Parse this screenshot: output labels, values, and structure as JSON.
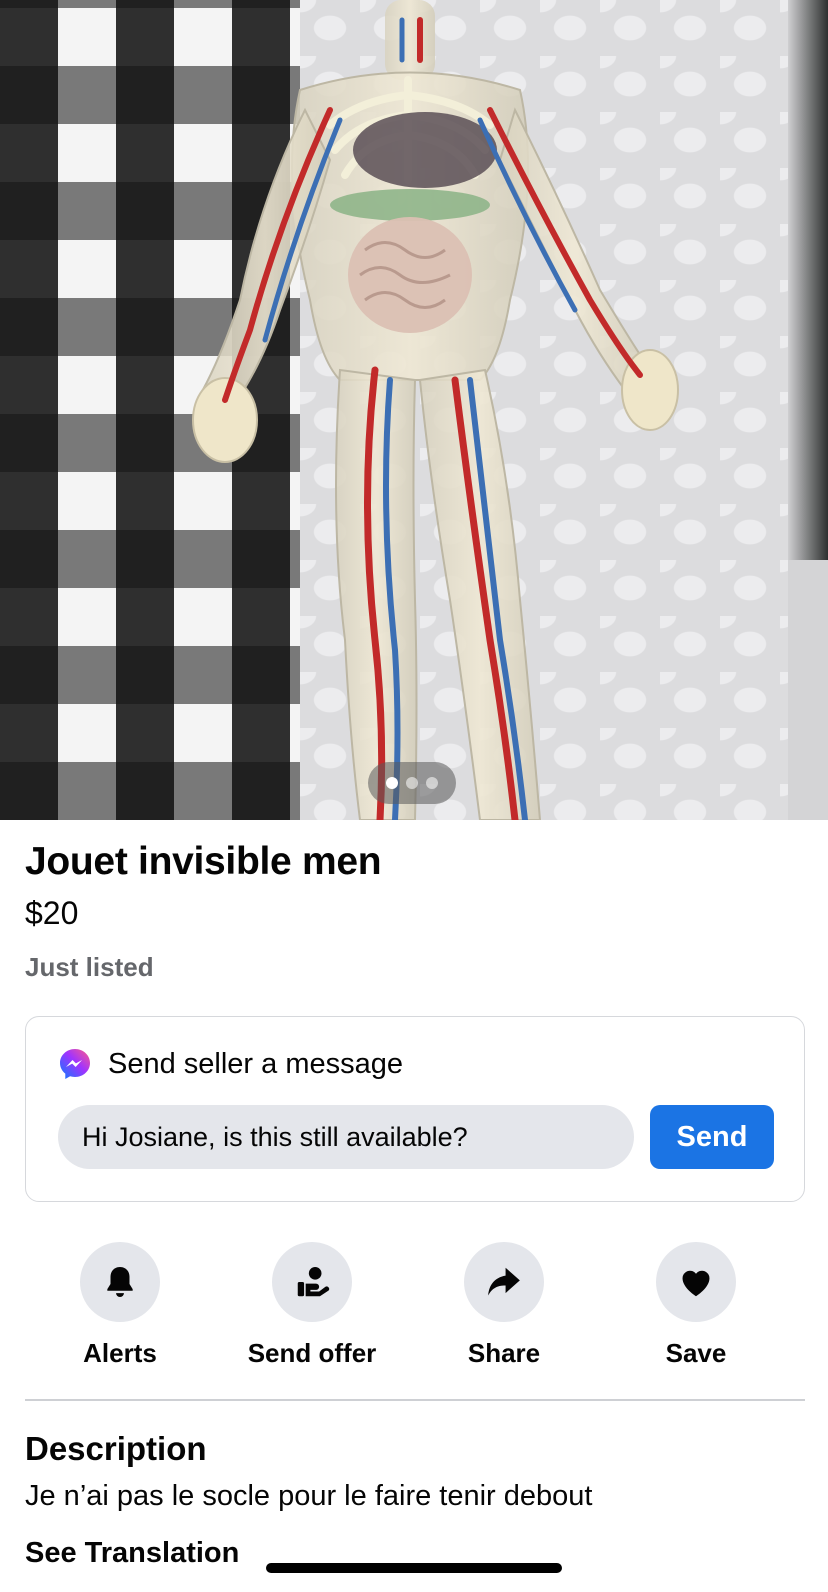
{
  "listing": {
    "title": "Jouet invisible men",
    "price": "$20",
    "status": "Just listed"
  },
  "photo": {
    "pager_count": 3,
    "pager_active_index": 0
  },
  "message": {
    "header": "Send seller a message",
    "icon": "messenger-icon",
    "input_value": "Hi Josiane, is this still available?",
    "send_label": "Send"
  },
  "actions": [
    {
      "label": "Alerts",
      "icon": "bell-icon"
    },
    {
      "label": "Send offer",
      "icon": "offer-hand-icon"
    },
    {
      "label": "Share",
      "icon": "share-arrow-icon"
    },
    {
      "label": "Save",
      "icon": "heart-icon"
    }
  ],
  "description": {
    "heading": "Description",
    "text": "Je n’ai pas le socle pour le faire tenir debout",
    "translate_link": "See Translation"
  },
  "colors": {
    "accent": "#1b74e4",
    "secondary_text": "#65676b",
    "chip_bg": "#e4e6eb"
  }
}
